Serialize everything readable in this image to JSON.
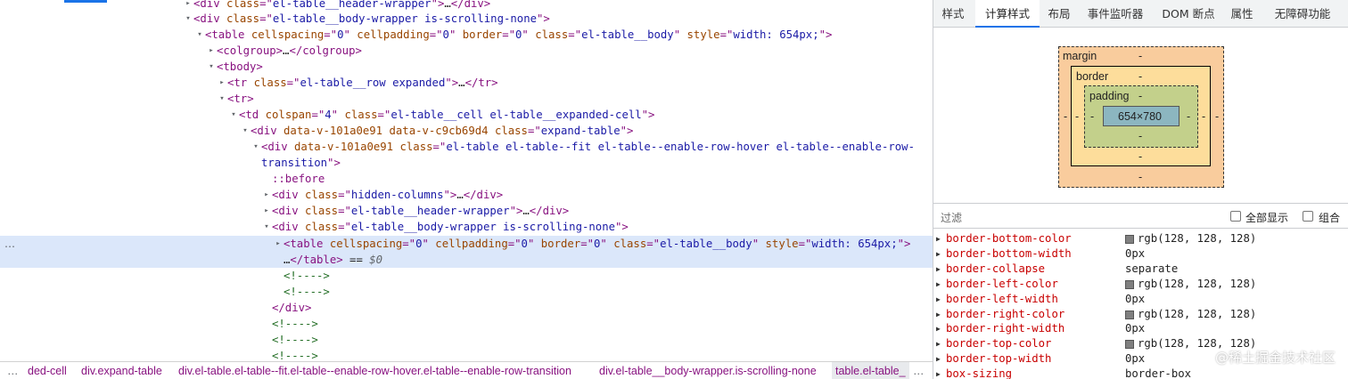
{
  "elements_tree": {
    "lines": [
      {
        "code": [
          [
            "tag",
            "<div "
          ],
          [
            "an",
            "class"
          ],
          [
            "tag",
            "=\""
          ],
          [
            "av",
            "el-table__header-wrapper"
          ],
          [
            "tag",
            "\">"
          ],
          [
            "txt",
            "…"
          ],
          [
            "tag",
            "</div>"
          ]
        ]
      },
      {
        "code": [
          [
            "tag",
            "<div "
          ],
          [
            "an",
            "class"
          ],
          [
            "tag",
            "=\""
          ],
          [
            "av",
            "el-table__body-wrapper is-scrolling-none"
          ],
          [
            "tag",
            "\">"
          ]
        ]
      },
      {
        "code": [
          [
            "tag",
            "<table "
          ],
          [
            "an",
            "cellspacing"
          ],
          [
            "tag",
            "=\""
          ],
          [
            "av",
            "0"
          ],
          [
            "tag",
            "\" "
          ],
          [
            "an",
            "cellpadding"
          ],
          [
            "tag",
            "=\""
          ],
          [
            "av",
            "0"
          ],
          [
            "tag",
            "\" "
          ],
          [
            "an",
            "border"
          ],
          [
            "tag",
            "=\""
          ],
          [
            "av",
            "0"
          ],
          [
            "tag",
            "\" "
          ],
          [
            "an",
            "class"
          ],
          [
            "tag",
            "=\""
          ],
          [
            "av",
            "el-table__body"
          ],
          [
            "tag",
            "\" "
          ],
          [
            "an",
            "style"
          ],
          [
            "tag",
            "=\""
          ],
          [
            "av",
            "width: 654px;"
          ],
          [
            "tag",
            "\">"
          ]
        ]
      },
      {
        "code": [
          [
            "tag",
            "<colgroup>"
          ],
          [
            "txt",
            "…"
          ],
          [
            "tag",
            "</colgroup>"
          ]
        ]
      },
      {
        "code": [
          [
            "tag",
            "<tbody>"
          ]
        ]
      },
      {
        "code": [
          [
            "tag",
            "<tr "
          ],
          [
            "an",
            "class"
          ],
          [
            "tag",
            "=\""
          ],
          [
            "av",
            "el-table__row expanded"
          ],
          [
            "tag",
            "\">"
          ],
          [
            "txt",
            "…"
          ],
          [
            "tag",
            "</tr>"
          ]
        ]
      },
      {
        "code": [
          [
            "tag",
            "<tr>"
          ]
        ]
      },
      {
        "code": [
          [
            "tag",
            "<td "
          ],
          [
            "an",
            "colspan"
          ],
          [
            "tag",
            "=\""
          ],
          [
            "av",
            "4"
          ],
          [
            "tag",
            "\" "
          ],
          [
            "an",
            "class"
          ],
          [
            "tag",
            "=\""
          ],
          [
            "av",
            "el-table__cell el-table__expanded-cell"
          ],
          [
            "tag",
            "\">"
          ]
        ]
      },
      {
        "code": [
          [
            "tag",
            "<div "
          ],
          [
            "an",
            "data-v-101a0e91 data-v-c9cb69d4 class"
          ],
          [
            "tag",
            "=\""
          ],
          [
            "av",
            "expand-table"
          ],
          [
            "tag",
            "\">"
          ]
        ]
      },
      {
        "code": [
          [
            "tag",
            "<div "
          ],
          [
            "an",
            "data-v-101a0e91 class"
          ],
          [
            "tag",
            "=\""
          ],
          [
            "av",
            "el-table el-table--fit el-table--enable-row-hover el-table--enable-row-"
          ]
        ]
      },
      {
        "code": [
          [
            "av",
            "transition"
          ],
          [
            "tag",
            "\">"
          ]
        ]
      },
      {
        "code": [
          [
            "tag",
            "::before"
          ]
        ]
      },
      {
        "code": [
          [
            "tag",
            "<div "
          ],
          [
            "an",
            "class"
          ],
          [
            "tag",
            "=\""
          ],
          [
            "av",
            "hidden-columns"
          ],
          [
            "tag",
            "\">"
          ],
          [
            "txt",
            "…"
          ],
          [
            "tag",
            "</div>"
          ]
        ]
      },
      {
        "code": [
          [
            "tag",
            "<div "
          ],
          [
            "an",
            "class"
          ],
          [
            "tag",
            "=\""
          ],
          [
            "av",
            "el-table__header-wrapper"
          ],
          [
            "tag",
            "\">"
          ],
          [
            "txt",
            "…"
          ],
          [
            "tag",
            "</div>"
          ]
        ]
      },
      {
        "code": [
          [
            "tag",
            "<div "
          ],
          [
            "an",
            "class"
          ],
          [
            "tag",
            "=\""
          ],
          [
            "av",
            "el-table__body-wrapper is-scrolling-none"
          ],
          [
            "tag",
            "\">"
          ]
        ]
      },
      {
        "code": [
          [
            "tag",
            "<table "
          ],
          [
            "an",
            "cellspacing"
          ],
          [
            "tag",
            "=\""
          ],
          [
            "av",
            "0"
          ],
          [
            "tag",
            "\" "
          ],
          [
            "an",
            "cellpadding"
          ],
          [
            "tag",
            "=\""
          ],
          [
            "av",
            "0"
          ],
          [
            "tag",
            "\" "
          ],
          [
            "an",
            "border"
          ],
          [
            "tag",
            "=\""
          ],
          [
            "av",
            "0"
          ],
          [
            "tag",
            "\" "
          ],
          [
            "an",
            "class"
          ],
          [
            "tag",
            "=\""
          ],
          [
            "av",
            "el-table__body"
          ],
          [
            "tag",
            "\" "
          ],
          [
            "an",
            "style"
          ],
          [
            "tag",
            "=\""
          ],
          [
            "av",
            "width: 654px;"
          ],
          [
            "tag",
            "\">"
          ]
        ]
      },
      {
        "code": [
          [
            "txt",
            "…"
          ],
          [
            "tag",
            "</table>"
          ],
          [
            "txt",
            " == "
          ],
          [
            "eq0",
            "$0"
          ]
        ]
      },
      {
        "code": [
          [
            "cmt",
            "<!---->"
          ]
        ]
      },
      {
        "code": [
          [
            "cmt",
            "<!---->"
          ]
        ]
      },
      {
        "code": [
          [
            "tag",
            "</div>"
          ]
        ]
      },
      {
        "code": [
          [
            "cmt",
            "<!---->"
          ]
        ]
      },
      {
        "code": [
          [
            "cmt",
            "<!---->"
          ]
        ]
      },
      {
        "code": [
          [
            "cmt",
            "<!---->"
          ]
        ]
      }
    ],
    "selected_marker": "…"
  },
  "breadcrumb": {
    "left_ellipsis": "…",
    "items": [
      "ded-cell",
      "div.expand-table",
      "div.el-table.el-table--fit.el-table--enable-row-hover.el-table--enable-row-transition",
      "div.el-table__body-wrapper.is-scrolling-none",
      "table.el-table_"
    ],
    "right_ellipsis": "…"
  },
  "side_panel": {
    "tabs": [
      "样式",
      "计算样式",
      "布局",
      "事件监听器",
      "DOM 断点",
      "属性",
      "无障碍功能"
    ],
    "active_tab": "计算样式",
    "box_model": {
      "margin_label": "margin",
      "border_label": "border",
      "padding_label": "padding",
      "dash": "-",
      "content_size": "654×780",
      "colors": {
        "margin": "#f9cc9d",
        "border": "#fddd9b",
        "padding": "#c3d08b",
        "content": "#8cb6c0"
      }
    },
    "filter": {
      "placeholder": "过滤",
      "show_all_label": "全部显示",
      "group_label": "组合"
    },
    "computed": [
      {
        "name": "border-bottom-color",
        "value": "rgb(128, 128, 128)",
        "swatch": "#808080"
      },
      {
        "name": "border-bottom-width",
        "value": "0px"
      },
      {
        "name": "border-collapse",
        "value": "separate"
      },
      {
        "name": "border-left-color",
        "value": "rgb(128, 128, 128)",
        "swatch": "#808080"
      },
      {
        "name": "border-left-width",
        "value": "0px"
      },
      {
        "name": "border-right-color",
        "value": "rgb(128, 128, 128)",
        "swatch": "#808080"
      },
      {
        "name": "border-right-width",
        "value": "0px"
      },
      {
        "name": "border-top-color",
        "value": "rgb(128, 128, 128)",
        "swatch": "#808080"
      },
      {
        "name": "border-top-width",
        "value": "0px"
      },
      {
        "name": "box-sizing",
        "value": "border-box"
      }
    ],
    "watermark": "@稀土掘金技术社区"
  }
}
